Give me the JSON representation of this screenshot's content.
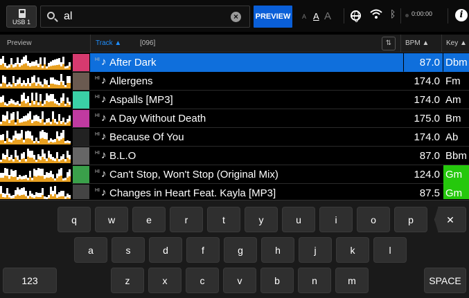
{
  "topbar": {
    "usb_label": "USB 1",
    "search_value": "al",
    "preview_label": "PREVIEW",
    "font_sizes": [
      "A",
      "A",
      "A"
    ],
    "time": "0:00:00",
    "info_label": "i"
  },
  "header": {
    "preview": "Preview",
    "track": "Track ▲",
    "count": "[096]",
    "bpm": "BPM ▲",
    "key": "Key ▲"
  },
  "tracks": [
    {
      "title": "After Dark",
      "bpm": "87.0",
      "key": "Dbm",
      "selected": true,
      "key_color": "",
      "art": "#d63a6f"
    },
    {
      "title": "Allergens",
      "bpm": "174.0",
      "key": "Fm",
      "selected": false,
      "key_color": "",
      "art": "#6a5a50"
    },
    {
      "title": "Aspalls [MP3]",
      "bpm": "174.0",
      "key": "Am",
      "selected": false,
      "key_color": "",
      "art": "#3ad0a6"
    },
    {
      "title": "A Day Without Death",
      "bpm": "175.0",
      "key": "Bm",
      "selected": false,
      "key_color": "",
      "art": "#c03aa0"
    },
    {
      "title": "Because Of You",
      "bpm": "174.0",
      "key": "Ab",
      "selected": false,
      "key_color": "",
      "art": "#222"
    },
    {
      "title": "B.L.O",
      "bpm": "87.0",
      "key": "Bbm",
      "selected": false,
      "key_color": "",
      "art": "#666"
    },
    {
      "title": "Can't Stop, Won't Stop (Original Mix)",
      "bpm": "124.0",
      "key": "Gm",
      "selected": false,
      "key_color": "#25c80c",
      "art": "#3aa04a"
    },
    {
      "title": "Changes in Heart Feat. Kayla [MP3]",
      "bpm": "87.5",
      "key": "Gm",
      "selected": false,
      "key_color": "#25c80c",
      "art": "#444"
    }
  ],
  "keyboard": {
    "row1": [
      "q",
      "w",
      "e",
      "r",
      "t",
      "y",
      "u",
      "i",
      "o",
      "p"
    ],
    "row2": [
      "a",
      "s",
      "d",
      "f",
      "g",
      "h",
      "j",
      "k",
      "l"
    ],
    "row3": [
      "z",
      "x",
      "c",
      "v",
      "b",
      "n",
      "m"
    ],
    "numbers_label": "123",
    "space_label": "SPACE",
    "backspace_label": "✕"
  }
}
